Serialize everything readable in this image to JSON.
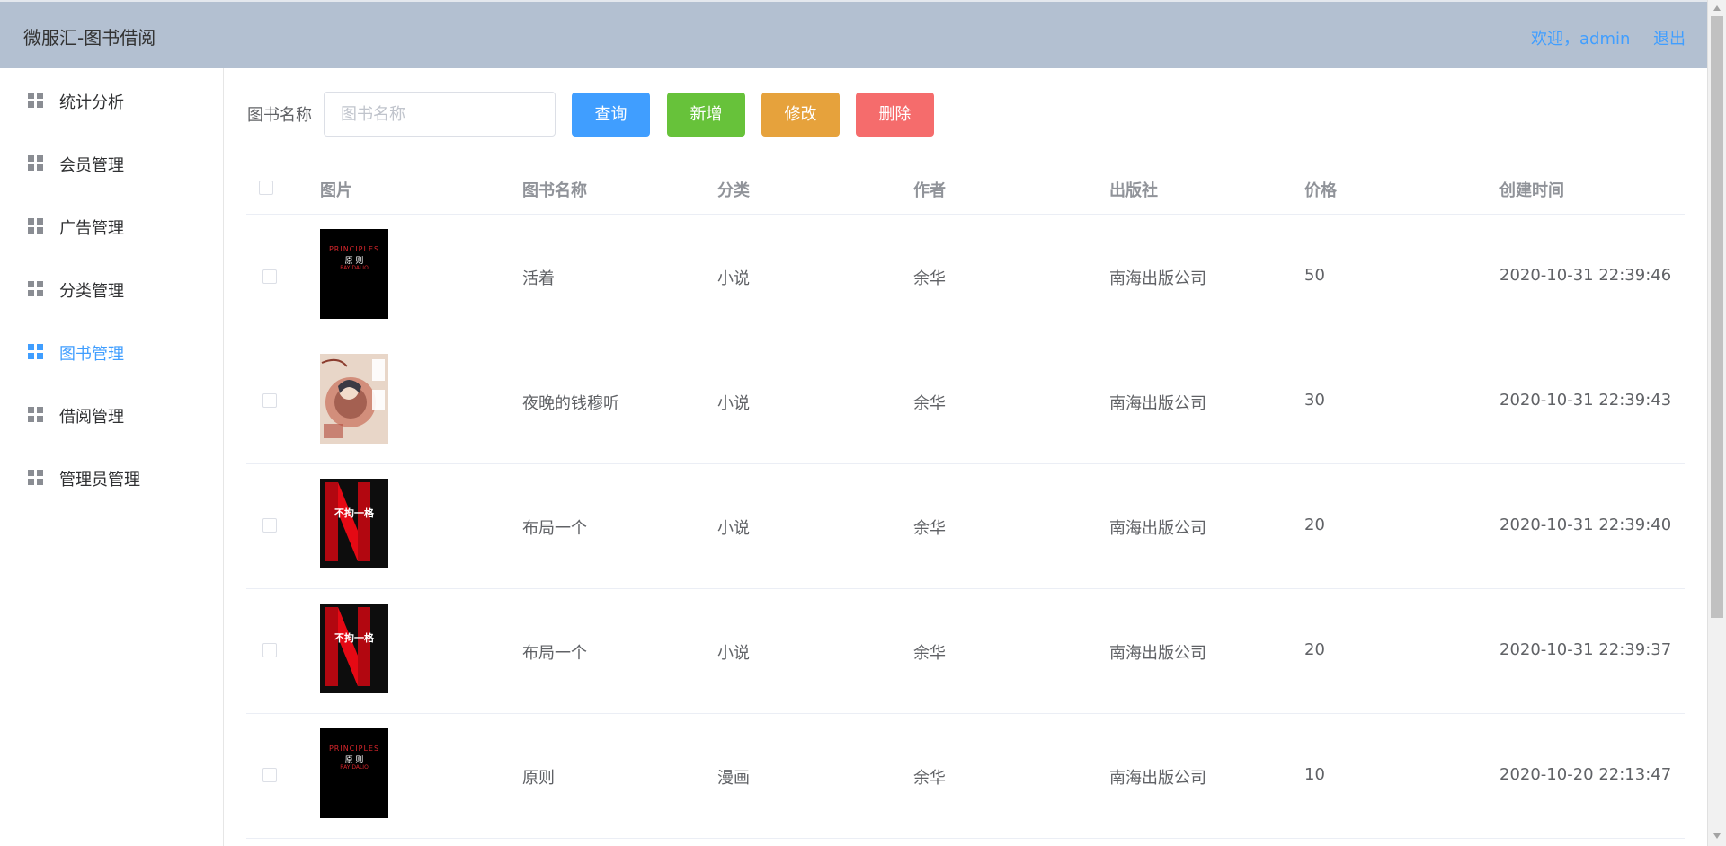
{
  "header": {
    "app_title": "微服汇-图书借阅",
    "welcome_text": "欢迎，admin",
    "logout_label": "退出"
  },
  "sidebar": {
    "items": [
      {
        "label": "统计分析",
        "active": false
      },
      {
        "label": "会员管理",
        "active": false
      },
      {
        "label": "广告管理",
        "active": false
      },
      {
        "label": "分类管理",
        "active": false
      },
      {
        "label": "图书管理",
        "active": true
      },
      {
        "label": "借阅管理",
        "active": false
      },
      {
        "label": "管理员管理",
        "active": false
      }
    ],
    "icon": "grid-icon"
  },
  "toolbar": {
    "search_label": "图书名称",
    "search_placeholder": "图书名称",
    "search_value": "",
    "query_label": "查询",
    "add_label": "新增",
    "edit_label": "修改",
    "delete_label": "删除",
    "colors": {
      "query": "#409eff",
      "add": "#67c23a",
      "edit": "#e6a23c",
      "delete": "#f56c6c"
    }
  },
  "table": {
    "columns": [
      "图片",
      "图书名称",
      "分类",
      "作者",
      "出版社",
      "价格",
      "创建时间"
    ],
    "rows": [
      {
        "cover": "principles",
        "name": "活着",
        "category": "小说",
        "author": "余华",
        "publisher": "南海出版公司",
        "price": "50",
        "created": "2020-10-31 22:39:46"
      },
      {
        "cover": "manga",
        "name": "夜晚的钱穆听",
        "category": "小说",
        "author": "余华",
        "publisher": "南海出版公司",
        "price": "30",
        "created": "2020-10-31 22:39:43"
      },
      {
        "cover": "netflix",
        "name": "布局一个",
        "category": "小说",
        "author": "余华",
        "publisher": "南海出版公司",
        "price": "20",
        "created": "2020-10-31 22:39:40"
      },
      {
        "cover": "netflix",
        "name": "布局一个",
        "category": "小说",
        "author": "余华",
        "publisher": "南海出版公司",
        "price": "20",
        "created": "2020-10-31 22:39:37"
      },
      {
        "cover": "principles",
        "name": "原则",
        "category": "漫画",
        "author": "余华",
        "publisher": "南海出版公司",
        "price": "10",
        "created": "2020-10-20 22:13:47"
      }
    ]
  },
  "covers": {
    "principles": {
      "line1": "PRINCIPLES",
      "line2": "原 则",
      "line3": "RAY DALIO"
    },
    "netflix": {
      "letter": "N",
      "title": "不拘一格"
    }
  }
}
